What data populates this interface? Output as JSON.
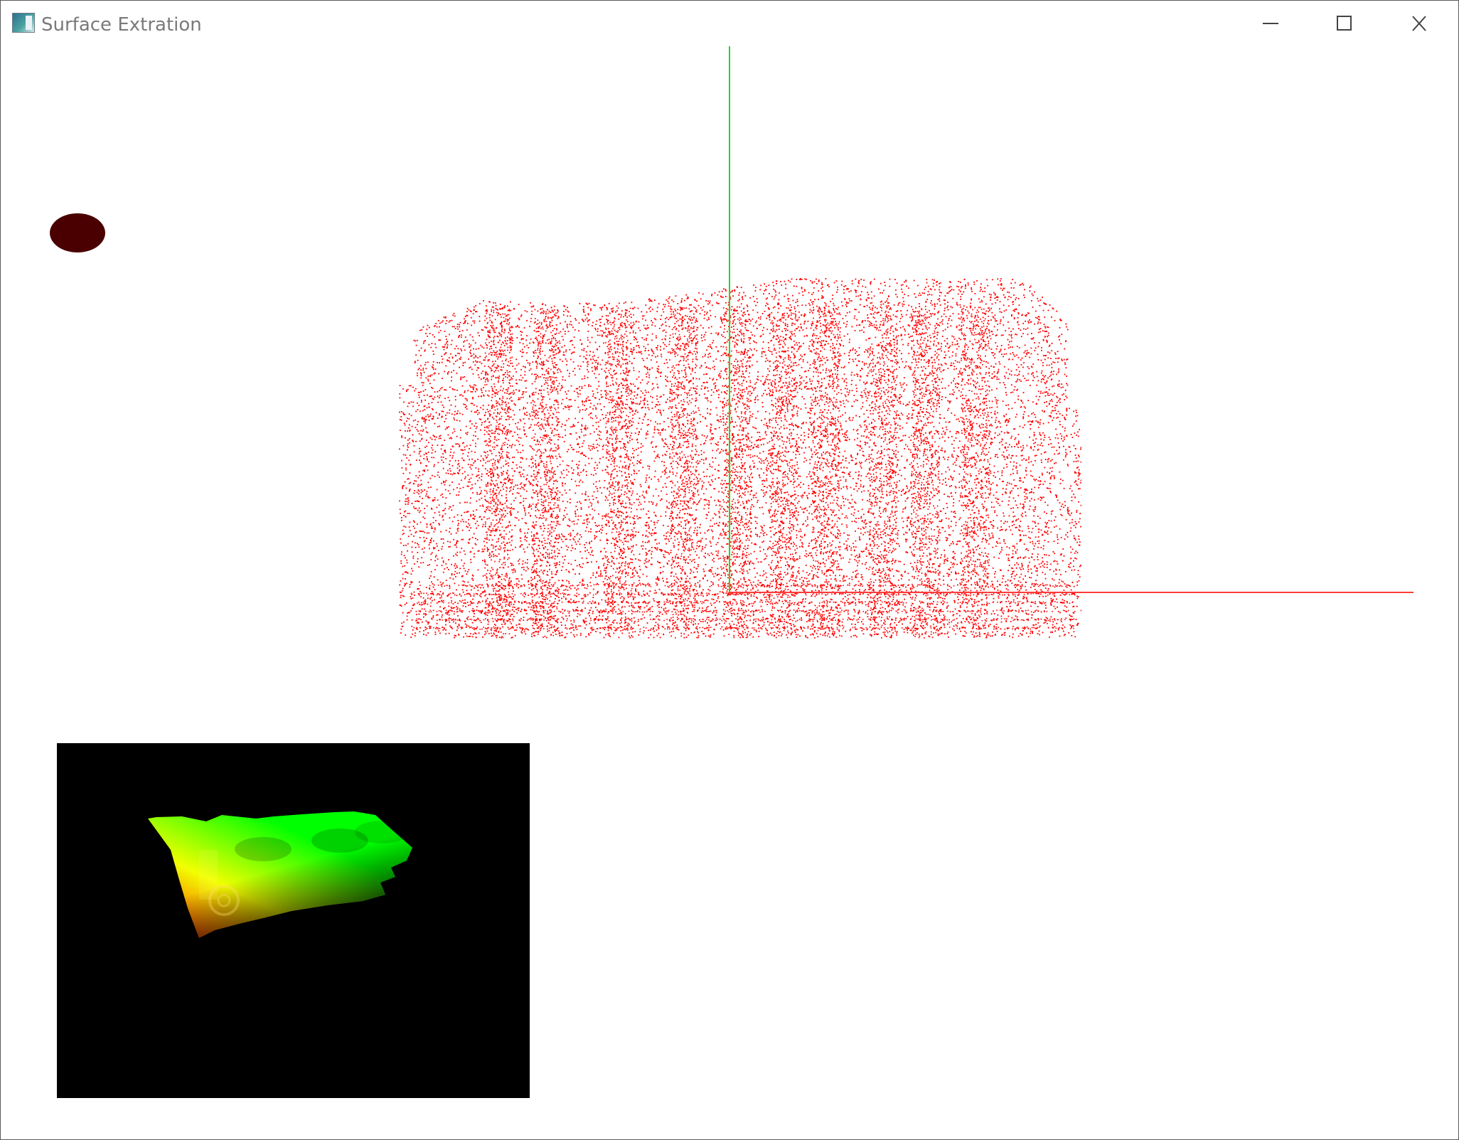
{
  "window": {
    "title": "Surface Extration",
    "app_icon": "window-app-icon"
  },
  "caption_buttons": [
    {
      "name": "minimize",
      "icon": "minimize-icon"
    },
    {
      "name": "maximize",
      "icon": "maximize-icon"
    },
    {
      "name": "close",
      "icon": "close-icon"
    }
  ],
  "scene": {
    "background": "#ffffff",
    "axis_colors": {
      "y": "#27d427",
      "x": "#ff3b3b"
    },
    "point_cloud_color": "#ff0000",
    "light_marker_color": "#4a0000"
  },
  "depth_view": {
    "background": "#000000",
    "gradient_colors": [
      "#ff0000",
      "#ffff00",
      "#00ff00"
    ]
  }
}
